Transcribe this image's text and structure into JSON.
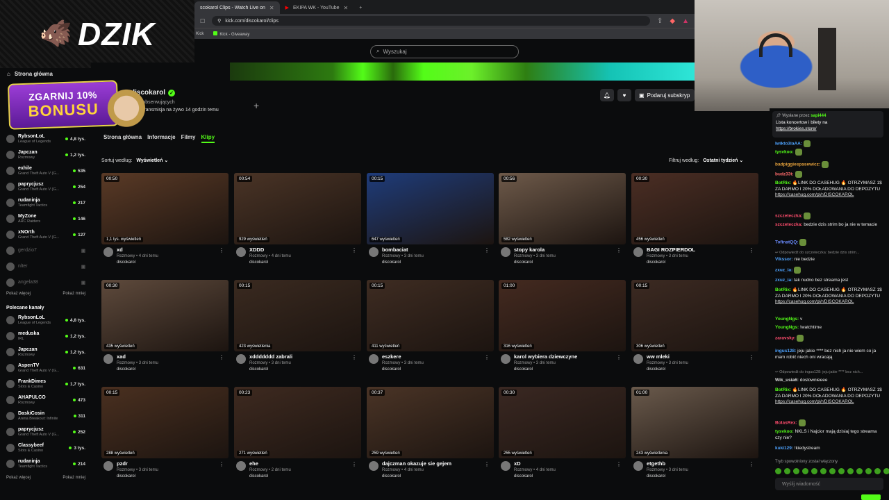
{
  "browser": {
    "tabs": [
      {
        "label": "scokarol Clips - Watch Live on",
        "active": true
      },
      {
        "label": "EKIPA WK - YouTube",
        "active": false
      }
    ],
    "url": "kick.com/discokarol/clips",
    "bookmarks": [
      "Kick",
      "Kick - Giveaway"
    ]
  },
  "logo": {
    "text": "DZIK"
  },
  "promo": {
    "line1": "ZGARNIJ 10%",
    "line2": "BONUSU"
  },
  "search": {
    "placeholder": "Wyszukaj"
  },
  "sidebar": {
    "home": "Strona główna",
    "followed": [
      {
        "name": "RybsonLoL",
        "game": "League of Legends",
        "viewers": "4,8 tys."
      },
      {
        "name": "Japczan",
        "game": "Rozmowy",
        "viewers": "1,2 tys."
      },
      {
        "name": "exhile",
        "game": "Grand Theft Auto V (G...",
        "viewers": "535"
      },
      {
        "name": "paprycjusz",
        "game": "Grand Theft Auto V (G...",
        "viewers": "254"
      },
      {
        "name": "rudaninja",
        "game": "Teamfight Tactics",
        "viewers": "217"
      },
      {
        "name": "MyZone",
        "game": "ARC Raiders",
        "viewers": "146"
      },
      {
        "name": "xNOrth",
        "game": "Grand Theft Auto V (G...",
        "viewers": "127"
      },
      {
        "name": "gerdzio7",
        "game": "",
        "viewers": ""
      },
      {
        "name": "nlter",
        "game": "",
        "viewers": ""
      },
      {
        "name": "angela38",
        "game": "",
        "viewers": ""
      }
    ],
    "show_more": "Pokaż więcej",
    "show_less": "Pokaż mniej",
    "recommended_header": "Polecane kanały",
    "recommended": [
      {
        "name": "RybsonLoL",
        "game": "League of Legends",
        "viewers": "4,8 tys."
      },
      {
        "name": "meduska",
        "game": "IRL",
        "viewers": "1,2 tys."
      },
      {
        "name": "Japczan",
        "game": "Rozmowy",
        "viewers": "1,2 tys."
      },
      {
        "name": "AspenTV",
        "game": "Grand Theft Auto V (G...",
        "viewers": "631"
      },
      {
        "name": "FrankDimes",
        "game": "Slots & Casino",
        "viewers": "1,7 tys."
      },
      {
        "name": "AHAPULCO",
        "game": "Rozmowy",
        "viewers": "473"
      },
      {
        "name": "DaskiCosin",
        "game": "Arena Breakout: Infinite",
        "viewers": "311"
      },
      {
        "name": "paprycjusz",
        "game": "Grand Theft Auto V (G...",
        "viewers": "252"
      },
      {
        "name": "Classybeef",
        "game": "Slots & Casino",
        "viewers": "3 tys."
      },
      {
        "name": "rudaninja",
        "game": "Teamfight Tactics",
        "viewers": "214"
      }
    ]
  },
  "channel": {
    "name": "discokarol",
    "followers": "s. obserwujących",
    "last_live": "ia transmisja na żywo 14 godzin temu",
    "subscribe_label": "Podaruj subskryp",
    "tabs": [
      "Strona główna",
      "Informacje",
      "Filmy",
      "Klipy"
    ],
    "active_tab": "Klipy",
    "sort_label": "Sortuj według:",
    "sort_value": "Wyświetleń",
    "filter_label": "Filtruj według:",
    "filter_value": "Ostatni tydzień"
  },
  "clips": [
    {
      "duration": "00:50",
      "views": "1,1 tys. wyświetleń",
      "title": "xd",
      "sub": "Rozmowy • 4 dni temu",
      "channel": "discokarol",
      "color": "#5a3a26"
    },
    {
      "duration": "00:54",
      "views": "929 wyświetleń",
      "title": "XDDD",
      "sub": "Rozmowy • 4 dni temu",
      "channel": "discokarol",
      "color": "#4a3426"
    },
    {
      "duration": "00:15",
      "views": "647 wyświetleń",
      "title": "bombaciat",
      "sub": "Rozmowy • 3 dni temu",
      "channel": "discokarol",
      "color": "#1f3c7a"
    },
    {
      "duration": "00:56",
      "views": "582 wyświetleń",
      "title": "stopy karola",
      "sub": "Rozmowy • 3 dni temu",
      "channel": "discokarol",
      "color": "#6e5a4a"
    },
    {
      "duration": "00:30",
      "views": "456 wyświetleń",
      "title": "BAGI ROZPIERDOL",
      "sub": "Rozmowy • 3 dni temu",
      "channel": "discokarol",
      "color": "#4b2e24"
    },
    {
      "duration": "00:30",
      "views": "435 wyświetleń",
      "title": "xad",
      "sub": "Rozmowy • 3 dni temu",
      "channel": "discokarol",
      "color": "#5e4a3c"
    },
    {
      "duration": "00:15",
      "views": "423 wyświetlenia",
      "title": "xddddddd zabrali",
      "sub": "Rozmowy • 3 dni temu",
      "channel": "discokarol",
      "color": "#3a2a20"
    },
    {
      "duration": "00:15",
      "views": "411 wyświetleń",
      "title": "eszkere",
      "sub": "Rozmowy • 3 dni temu",
      "channel": "discokarol",
      "color": "#3e2c22"
    },
    {
      "duration": "01:00",
      "views": "316 wyświetleń",
      "title": "karol wybiera dziewczyne",
      "sub": "Rozmowy • 3 dni temu",
      "channel": "discokarol",
      "color": "#442a20"
    },
    {
      "duration": "00:15",
      "views": "306 wyświetleń",
      "title": "ww mleki",
      "sub": "Rozmowy • 3 dni temu",
      "channel": "discokarol",
      "color": "#3c2a22"
    },
    {
      "duration": "00:15",
      "views": "288 wyświetleń",
      "title": "pzdr",
      "sub": "Rozmowy • 3 dni temu",
      "channel": "discokarol",
      "color": "#4a3020"
    },
    {
      "duration": "00:23",
      "views": "271 wyświetleń",
      "title": "ehe",
      "sub": "Rozmowy • 2 dni temu",
      "channel": "discokarol",
      "color": "#3e2a20"
    },
    {
      "duration": "00:37",
      "views": "259 wyświetleń",
      "title": "dajczman okazuje sie gejem",
      "sub": "Rozmowy • 4 dni temu",
      "channel": "discokarol",
      "color": "#4a3426"
    },
    {
      "duration": "00:30",
      "views": "255 wyświetleń",
      "title": "xD",
      "sub": "Rozmowy • 4 dni temu",
      "channel": "discokarol",
      "color": "#3a2822"
    },
    {
      "duration": "01:00",
      "views": "243 wyświetlenia",
      "title": "etgethb",
      "sub": "Rozmowy • 3 dni temu",
      "channel": "discokarol",
      "color": "#6a5a4c"
    }
  ],
  "chat": {
    "pinned_header": "Wysłane przez",
    "pinned_user": "sapi444",
    "pinned_text": "Lista koncertow i bilety na",
    "pinned_link": "https://brokies.store/",
    "messages": [
      {
        "user": "lwikto3iaAA:",
        "text": "",
        "color": "#4ea3ff"
      },
      {
        "user": "tysvkoo:",
        "text": "",
        "color": "#53fc18"
      },
      {
        "user": "badpiggiespasewicz:",
        "text": "",
        "color": "#e6a23c"
      },
      {
        "user": "budz33t:",
        "text": "",
        "color": "#ff6b6b"
      },
      {
        "user": "BotRix:",
        "text": "🔥LINK DO CASEHUG 🔥 OTRZYMASZ 1$ ZA DARMO I 20% DOŁADOWANIA DO DEPOZYTU",
        "link": "https://casehug.com/pl/r/DISCOKAROL",
        "color": "#53fc18"
      },
      {
        "user": "szczeteczka:",
        "text": "",
        "color": "#ff4d6d"
      },
      {
        "user": "szczeteczka:",
        "text": "bedzie dzis strim bo ja nie w temacie",
        "color": "#ff4d6d"
      },
      {
        "user": "TofinatQQ:",
        "text": "",
        "color": "#6c8cff"
      },
      {
        "user": "",
        "text": "↩ Odpowiedź do szczeteczka: bedzie dzis strim...",
        "color": "#888"
      },
      {
        "user": "Vikssor:",
        "text": "nie bedzie",
        "color": "#4ea3ff"
      },
      {
        "user": "zxuz_ia:",
        "text": "",
        "color": "#4ea3ff"
      },
      {
        "user": "zxuz_ia:",
        "text": "tak nudno bez streama jest",
        "color": "#4ea3ff"
      },
      {
        "user": "BotRix:",
        "text": "🔥LINK DO CASEHUG 🔥 OTRZYMASZ 1$ ZA DARMO I 20% DOŁADOWANIA DO DEPOZYTU",
        "link": "https://casehug.com/pl/r/DISCOKAROL",
        "color": "#53fc18"
      },
      {
        "user": "YoungNgs:",
        "text": "v",
        "color": "#53fc18"
      },
      {
        "user": "YoungNgs:",
        "text": "!watchtime",
        "color": "#53fc18"
      },
      {
        "user": "zaravsky:",
        "text": "",
        "color": "#ff4d6d"
      },
      {
        "user": "ingus128:",
        "text": "jeju jakie **** bez nich ja nie wiem co ja mam robić niech oni wracają",
        "color": "#4ea3ff"
      },
      {
        "user": "",
        "text": "↩ Odpowiedź do ingus128: jeju jakie **** bez nich...",
        "color": "#888"
      },
      {
        "user": "Wik_usia6:",
        "text": "doslowniееее",
        "color": "#ddd"
      },
      {
        "user": "BotRix:",
        "text": "🔥LINK DO CASEHUG 🔥 OTRZYMASZ 1$ ZA DARMO I 20% DOŁADOWANIA DO DEPOZYTU",
        "link": "https://casehug.com/pl/r/DISCOKAROL",
        "color": "#53fc18"
      },
      {
        "user": "BolasRex:",
        "text": "",
        "color": "#ff4d6d"
      },
      {
        "user": "tysvkoo:",
        "text": "NKLS i Najcior mają dzisiaj tego streama czy nie?",
        "color": "#53fc18"
      },
      {
        "user": "kuki129:",
        "text": "!kiedystream",
        "color": "#4ea3ff"
      }
    ],
    "slow_mode": "Tryb spowolniony został włączony",
    "input_placeholder": "Wyślij wiadomość"
  },
  "colors": {
    "accent": "#53fc18",
    "bg": "#0b0c0d"
  }
}
